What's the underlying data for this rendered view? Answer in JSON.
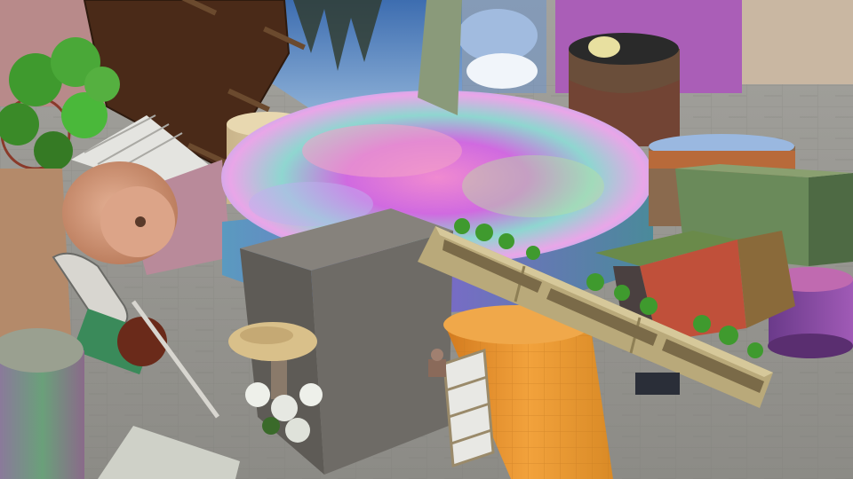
{
  "scene": {
    "description_visible_text": "",
    "palette": {
      "floor": "#8f8e8a",
      "floor_dark": "#6f6e6a",
      "sky": "#5a86c4",
      "cloud": "#e8eef6",
      "wood_dark": "#4a2a18",
      "rainbow_a": "#e86ad8",
      "rainbow_b": "#7fc6e8",
      "stone_cube": "#6e6b66",
      "orange_cyl": "#e8962e",
      "planter": "#b9a97a",
      "leaf": "#3f9a2e",
      "terracotta": "#d39a7c",
      "purple_cyl": "#8a4aa0",
      "green_cyl": "#6aa07a",
      "blossom": "#c64a8a",
      "sand": "#d9c49a",
      "plank_white": "#e4e4e0"
    },
    "objects": [
      "checkered-stone-floor",
      "sky-mirrored-backdrop",
      "wooden-board-with-pegs",
      "leafy-plant",
      "rainbow-cylinder",
      "stone-cube",
      "orange-tile-cylinder",
      "planter-box-with-plants",
      "terracotta-pot",
      "guitar",
      "sand-cylinder",
      "purple-cylinder",
      "mossy-cube",
      "photo-cube",
      "green-cylinder",
      "mushroom-stool",
      "white-shelf",
      "patterned-dome-cylinder"
    ]
  }
}
